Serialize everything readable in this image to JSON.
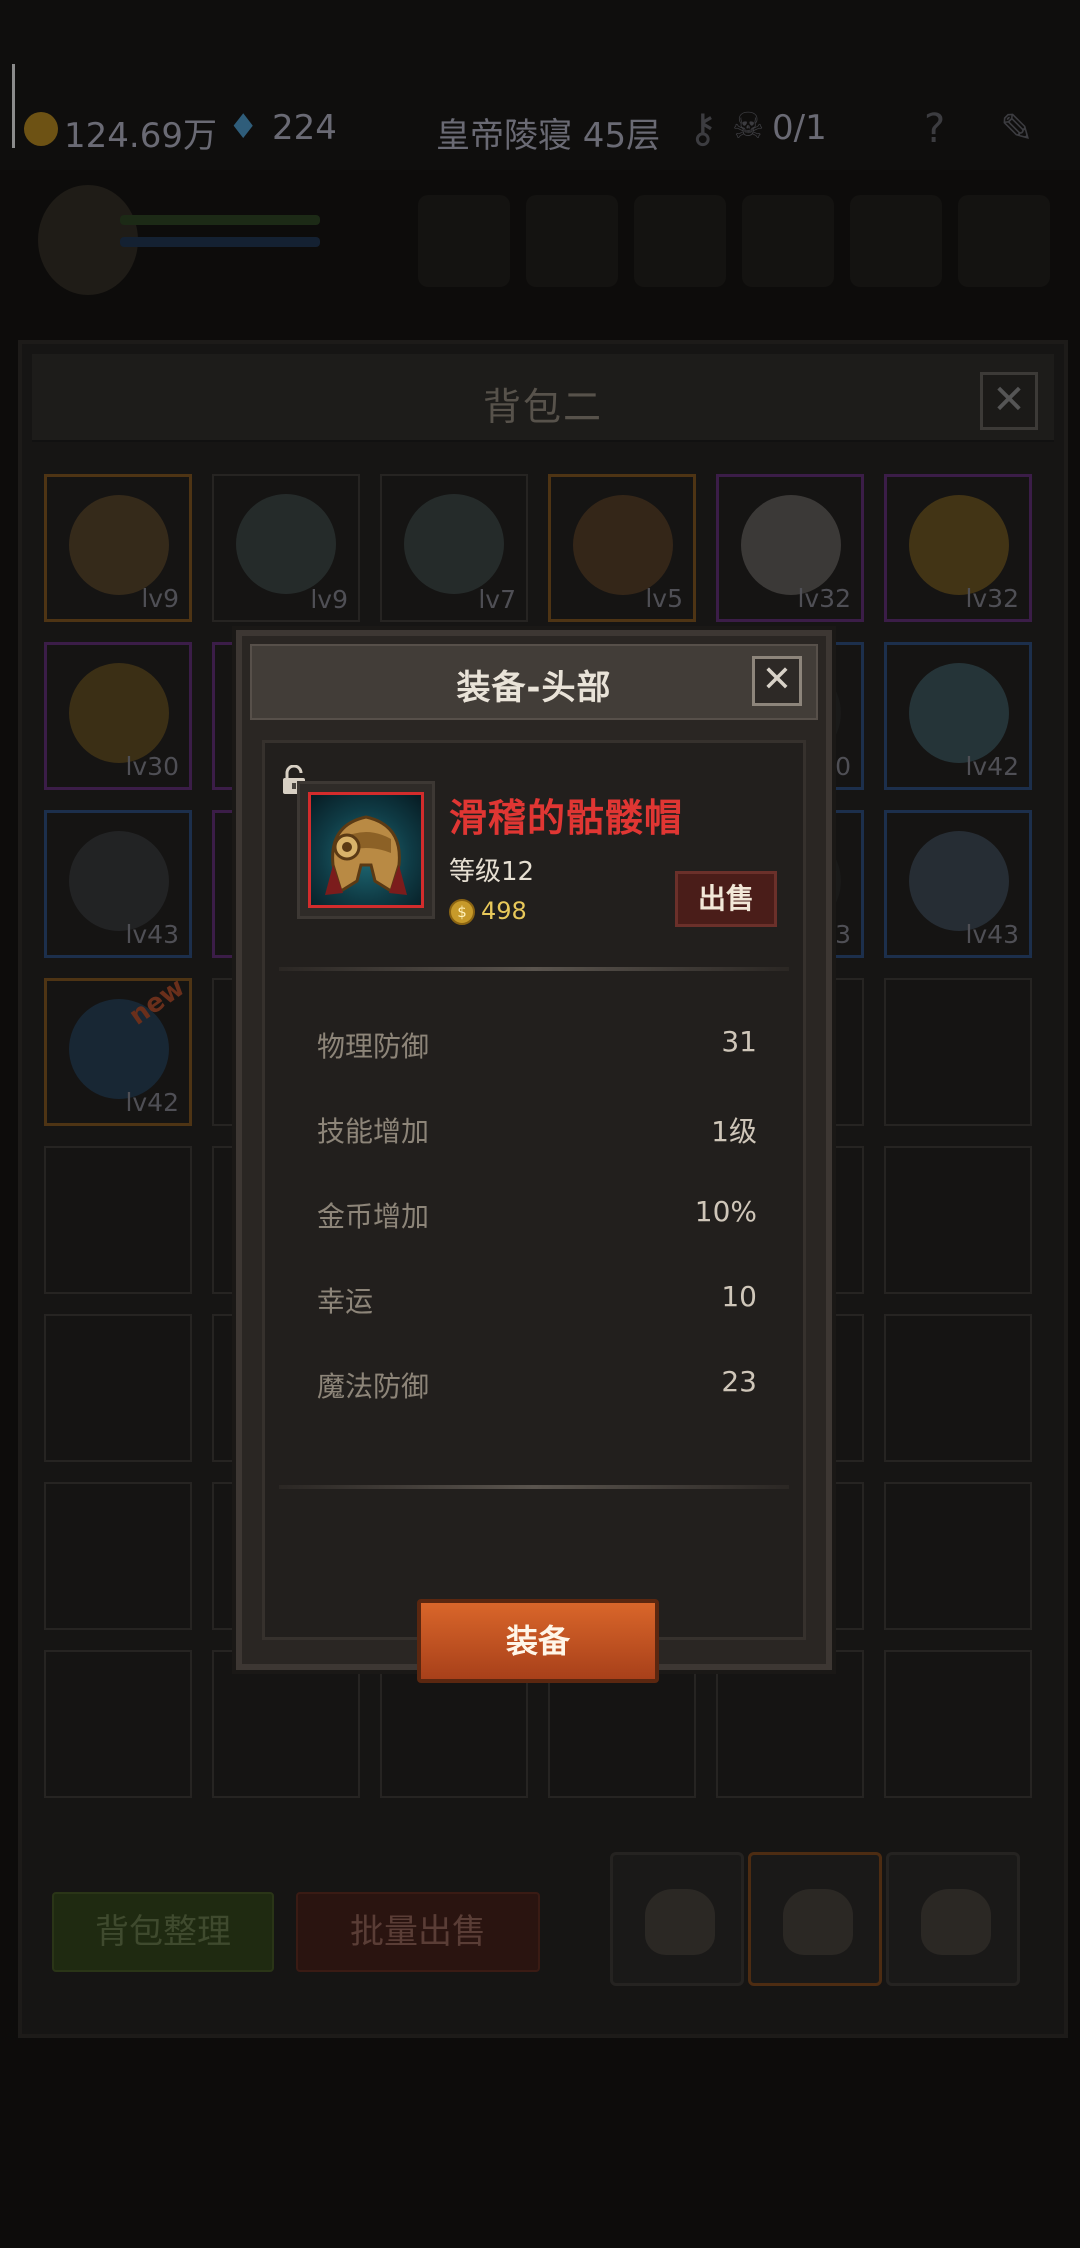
{
  "hud": {
    "gold": "124.69万",
    "gems": "224",
    "floor": "皇帝陵寝 45层",
    "keys": "0/1",
    "help": "?"
  },
  "bag": {
    "title": "背包二",
    "close": "✕",
    "items": [
      {
        "level": "lv9",
        "rarity": "orange",
        "art": "#5e4424"
      },
      {
        "level": "lv9",
        "rarity": "gray",
        "art": "#3a4646"
      },
      {
        "level": "lv7",
        "rarity": "gray",
        "art": "#3a4646"
      },
      {
        "level": "lv5",
        "rarity": "orange",
        "art": "#5a3b20"
      },
      {
        "level": "lv32",
        "rarity": "purple",
        "art": "#6a6663"
      },
      {
        "level": "lv32",
        "rarity": "purple",
        "art": "#7a5a18"
      },
      {
        "level": "lv30",
        "rarity": "purple",
        "art": "#6b5018"
      },
      {
        "level": "",
        "rarity": "purple",
        "art": "#222"
      },
      {
        "level": "",
        "rarity": "gray",
        "art": "#222"
      },
      {
        "level": "",
        "rarity": "gray",
        "art": "#222"
      },
      {
        "level": "0",
        "rarity": "blue",
        "art": "#222"
      },
      {
        "level": "lv42",
        "rarity": "blue",
        "art": "#3a5a66"
      },
      {
        "level": "lv43",
        "rarity": "blue",
        "art": "#33363a"
      },
      {
        "level": "",
        "rarity": "purple",
        "art": "#222"
      },
      {
        "level": "",
        "rarity": "gray",
        "art": "#222"
      },
      {
        "level": "",
        "rarity": "gray",
        "art": "#222"
      },
      {
        "level": "3",
        "rarity": "blue",
        "art": "#222"
      },
      {
        "level": "lv43",
        "rarity": "blue",
        "art": "#3b4b5e"
      },
      {
        "level": "lv42",
        "rarity": "orange",
        "art": "#1d3e5e",
        "tag": "new"
      }
    ],
    "sort_label": "背包整理",
    "bulk_sell_label": "批量出售"
  },
  "dialog": {
    "title": "装备-头部",
    "close": "✕",
    "item": {
      "name": "滑稽的骷髅帽",
      "level": "等级12",
      "price": "498",
      "coin_symbol": "$",
      "sell_label": "出售"
    },
    "stats": [
      {
        "label": "物理防御",
        "value": "31"
      },
      {
        "label": "技能增加",
        "value": "1级"
      },
      {
        "label": "金币增加",
        "value": "10%"
      },
      {
        "label": "幸运",
        "value": "10"
      },
      {
        "label": "魔法防御",
        "value": "23"
      }
    ],
    "equip_label": "装备"
  }
}
